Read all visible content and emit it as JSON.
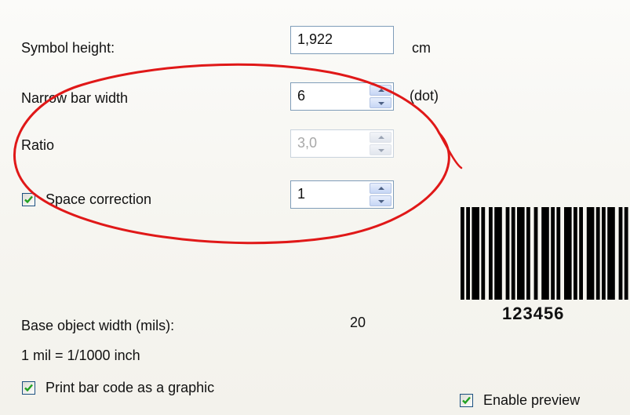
{
  "form": {
    "symbol_height": {
      "label": "Symbol height:",
      "value": "1,922",
      "unit": "cm"
    },
    "narrow_bar_width": {
      "label": "Narrow bar width",
      "value": "6",
      "unit": "(dot)"
    },
    "ratio": {
      "label": "Ratio",
      "value": "3,0"
    },
    "space_correction": {
      "label": "Space correction",
      "value": "1",
      "checked": true
    },
    "base_object_width": {
      "label": "Base object width (mils):",
      "value": "20"
    },
    "mil_note": "1 mil = 1/1000 inch",
    "print_as_graphic": {
      "label": "Print bar code as a graphic",
      "checked": true
    }
  },
  "preview": {
    "barcode_text": "123456",
    "enable_preview": {
      "label": "Enable preview",
      "checked": true
    }
  },
  "colors": {
    "annotation_oval": "#e01818",
    "checkmark": "#21a121",
    "field_border": "#7f9db9"
  },
  "icons": [
    "checkbox-checked-icon",
    "spin-up-icon",
    "spin-down-icon",
    "barcode-graphic"
  ]
}
